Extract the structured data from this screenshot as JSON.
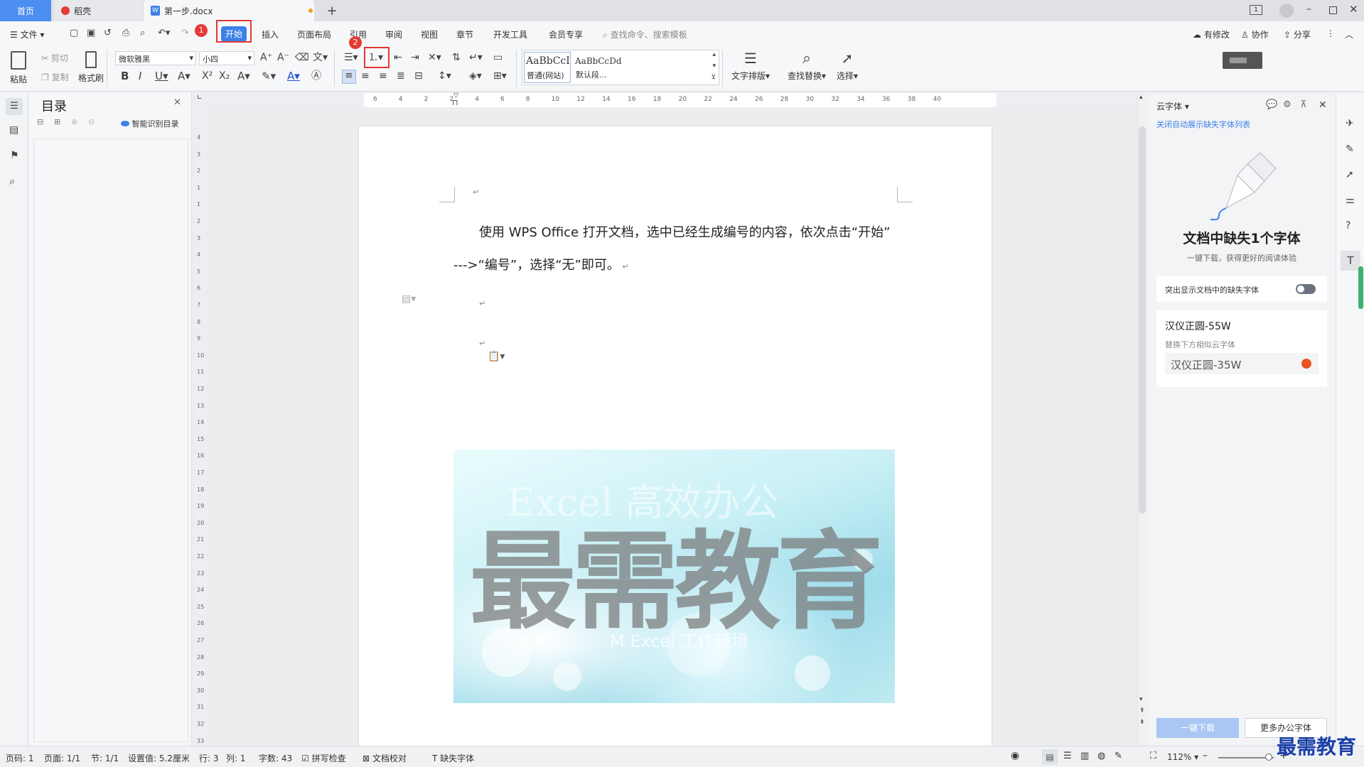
{
  "tabs": {
    "home": "首页",
    "daoke": "稻壳",
    "doc": "第一步.docx",
    "add": "+"
  },
  "window": {
    "mode_icon": "1"
  },
  "menubar": {
    "file": "文件",
    "items": [
      "开始",
      "插入",
      "页面布局",
      "引用",
      "审阅",
      "视图",
      "章节",
      "开发工具",
      "会员专享"
    ],
    "search_placeholder": "查找命令、搜索模板",
    "right": [
      "有修改",
      "协作",
      "分享"
    ]
  },
  "badges": [
    "1",
    "2"
  ],
  "ribbon": {
    "paste": "粘贴",
    "cut": "剪切",
    "copy": "复制",
    "format_painter": "格式刷",
    "font": "微软雅黑",
    "size": "小四",
    "style1_preview": "AaBbCcI",
    "style1_name": "普通(网站)",
    "style2_preview": "AaBbCcDd",
    "style2_name": "默认段...",
    "text_layout": "文字排版",
    "find_replace": "查找替换",
    "select": "选择"
  },
  "navpane": {
    "title": "目录",
    "smart_toc": "智能识别目录"
  },
  "hruler_ticks": [
    "6",
    "4",
    "2",
    "2",
    "4",
    "6",
    "8",
    "10",
    "12",
    "14",
    "16",
    "18",
    "20",
    "22",
    "24",
    "26",
    "28",
    "30",
    "32",
    "34",
    "36",
    "38",
    "40"
  ],
  "vruler_ticks": [
    "4",
    "3",
    "2",
    "1",
    "1",
    "2",
    "3",
    "4",
    "5",
    "6",
    "7",
    "8",
    "9",
    "10",
    "11",
    "12",
    "13",
    "14",
    "15",
    "16",
    "17",
    "18",
    "19",
    "20",
    "21",
    "22",
    "23",
    "24",
    "25",
    "26",
    "27",
    "28",
    "29",
    "30",
    "31",
    "32",
    "33"
  ],
  "document": {
    "line1": "使用 WPS Office 打开文档，选中已经生成编号的内容，依次点击“开始”",
    "line2": "--->“编号”，选择“无”即可。",
    "image": {
      "watermark": "最需教育",
      "top_text": "Excel 高效办公",
      "bottom_text": "M Excel 工作环境"
    }
  },
  "rightpane": {
    "title": "云字体",
    "close_auto": "关闭自动展示缺失字体列表",
    "heading": "文档中缺失1个字体",
    "subheading": "一键下载，获得更好的阅读体验",
    "toggle_label": "突出显示文档中的缺失字体",
    "toggle_on": false,
    "font_name": "汉仪正圆-55W",
    "replace_hint": "替换下方相似云字体",
    "replace_font": "汉仪正圆-35W",
    "download_btn": "一键下载",
    "more_btn": "更多办公字体"
  },
  "statusbar": {
    "page_code": "页码: 1",
    "page": "页面: 1/1",
    "section": "节: 1/1",
    "setting": "设置值: 5.2厘米",
    "row": "行: 3",
    "col": "列: 1",
    "chars": "字数: 43",
    "spell": "拼写检查",
    "proof": "文档校对",
    "missing_font": "缺失字体",
    "zoom": "112%"
  },
  "watermark_corner": "最需教育"
}
